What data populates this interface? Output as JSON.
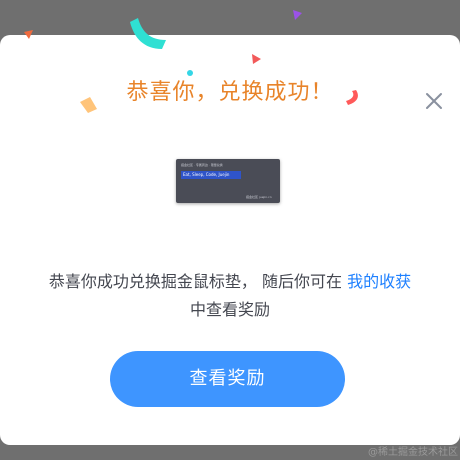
{
  "modal": {
    "title": "恭喜你，兑换成功！",
    "close_icon": "close-icon",
    "prize_image": {
      "caption_top": "掘金社区 · 专属周边 · 限量兑换",
      "tag_text": "Eat, Sleep, Code, Juejin",
      "caption_bottom": "掘金社区 juejin.cn"
    },
    "message": {
      "before": "恭喜你成功兑换掘金鼠标垫，  随后你可在 ",
      "link": "我的收获",
      "after": "中查看奖励"
    },
    "cta_label": "查看奖励"
  },
  "watermark": "@稀土掘金技术社区",
  "colors": {
    "title": "#e8842a",
    "link": "#1e80ff",
    "button": "#3e95ff",
    "backdrop": "#6f6f6f"
  },
  "confetti_icons": [
    "teal-ribbon",
    "purple-triangle",
    "red-triangle",
    "orange-triangle",
    "orange-ribbon",
    "cyan-dot",
    "red-ribbon"
  ]
}
